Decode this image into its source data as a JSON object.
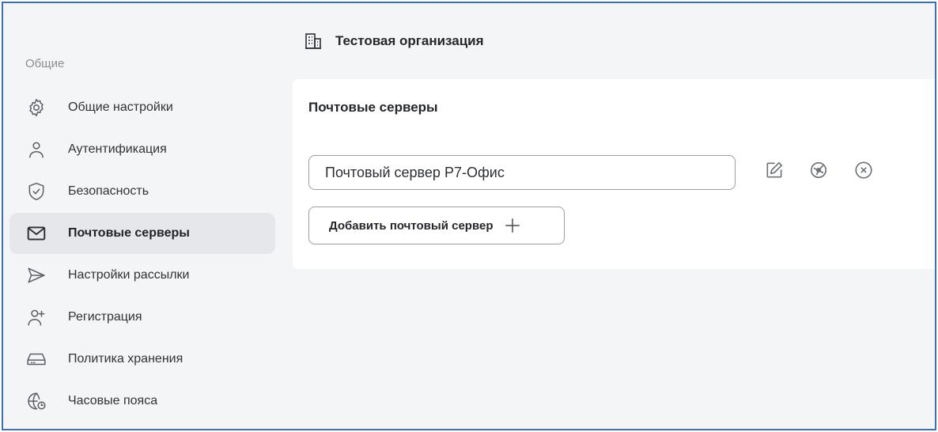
{
  "sidebar": {
    "section_label": "Общие",
    "items": [
      {
        "label": "Общие настройки",
        "icon": "gear-icon"
      },
      {
        "label": "Аутентификация",
        "icon": "user-icon"
      },
      {
        "label": "Безопасность",
        "icon": "shield-check-icon"
      },
      {
        "label": "Почтовые серверы",
        "icon": "mail-icon",
        "active": true
      },
      {
        "label": "Настройки рассылки",
        "icon": "send-icon"
      },
      {
        "label": "Регистрация",
        "icon": "user-add-icon"
      },
      {
        "label": "Политика хранения",
        "icon": "storage-drive-icon"
      },
      {
        "label": "Часовые пояса",
        "icon": "globe-clock-icon"
      }
    ]
  },
  "header": {
    "org_name": "Тестовая организация",
    "icon": "building-icon"
  },
  "panel": {
    "title": "Почтовые серверы",
    "server_name": "Почтовый сервер Р7-Офис",
    "actions": [
      "edit-icon",
      "test-connection-icon",
      "remove-icon"
    ],
    "add_button_label": "Добавить почтовый сервер"
  },
  "colors": {
    "background": "#f4f5f7",
    "active_item": "#e6e7ea",
    "frame_border": "#3f6fb3"
  }
}
